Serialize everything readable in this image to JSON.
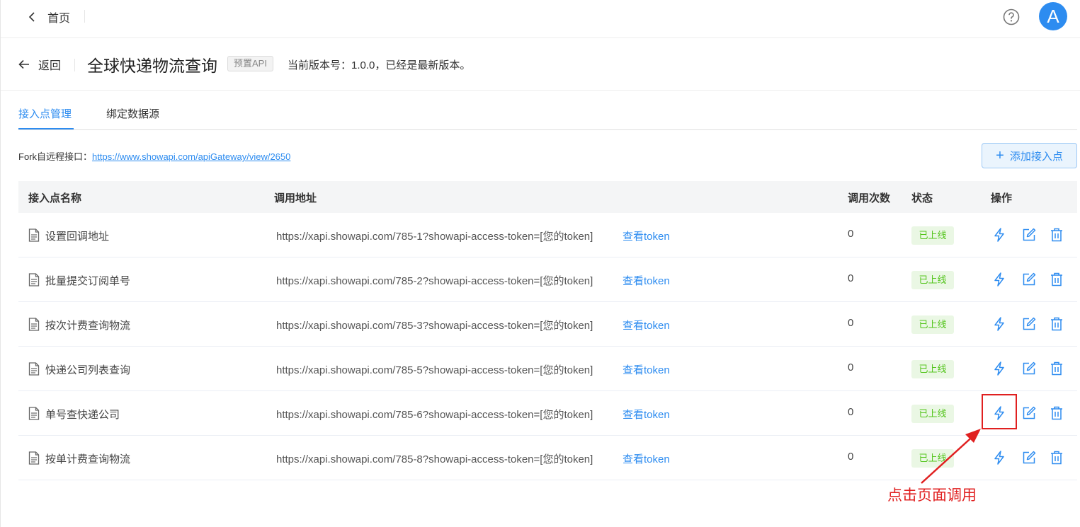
{
  "topbar": {
    "back_label": "首页"
  },
  "header": {
    "back_label": "返回",
    "title": "全球快递物流查询",
    "badge": "预置API",
    "version_text": "当前版本号：1.0.0，已经是最新版本。"
  },
  "tabs": [
    {
      "label": "接入点管理",
      "active": true
    },
    {
      "label": "绑定数据源",
      "active": false
    }
  ],
  "fork": {
    "label": "Fork自远程接口：",
    "link": "https://www.showapi.com/apiGateway/view/2650"
  },
  "add_button_label": "添加接入点",
  "table": {
    "headers": [
      "接入点名称",
      "调用地址",
      "调用次数",
      "状态",
      "操作"
    ],
    "rows": [
      {
        "name": "设置回调地址",
        "url": "https://xapi.showapi.com/785-1?showapi-access-token=[您的token]",
        "token_label": "查看token",
        "count": "0",
        "status": "已上线"
      },
      {
        "name": "批量提交订阅单号",
        "url": "https://xapi.showapi.com/785-2?showapi-access-token=[您的token]",
        "token_label": "查看token",
        "count": "0",
        "status": "已上线"
      },
      {
        "name": "按次计费查询物流",
        "url": "https://xapi.showapi.com/785-3?showapi-access-token=[您的token]",
        "token_label": "查看token",
        "count": "0",
        "status": "已上线"
      },
      {
        "name": "快递公司列表查询",
        "url": "https://xapi.showapi.com/785-5?showapi-access-token=[您的token]",
        "token_label": "查看token",
        "count": "0",
        "status": "已上线"
      },
      {
        "name": "单号查快递公司",
        "url": "https://xapi.showapi.com/785-6?showapi-access-token=[您的token]",
        "token_label": "查看token",
        "count": "0",
        "status": "已上线"
      },
      {
        "name": "按单计费查询物流",
        "url": "https://xapi.showapi.com/785-8?showapi-access-token=[您的token]",
        "token_label": "查看token",
        "count": "0",
        "status": "已上线"
      }
    ]
  },
  "annotation": {
    "text": "点击页面调用"
  },
  "colors": {
    "accent": "#2d8cf0",
    "success": "#52c41a",
    "annotation": "#e02020"
  },
  "icons": [
    "chevron-left-icon",
    "help-icon",
    "arrow-left-icon",
    "plus-icon",
    "document-icon",
    "lightning-icon",
    "edit-icon",
    "trash-icon"
  ]
}
